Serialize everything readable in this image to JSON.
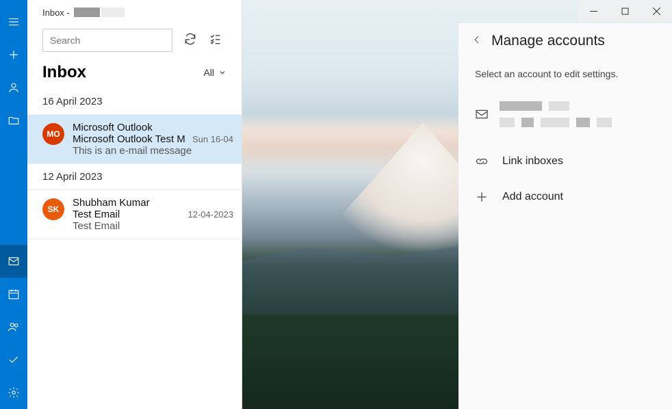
{
  "window": {
    "title_prefix": "Inbox -"
  },
  "search": {
    "placeholder": "Search"
  },
  "folder": {
    "name": "Inbox",
    "filter": "All"
  },
  "groups": [
    {
      "date": "16 April 2023",
      "messages": [
        {
          "initials": "MO",
          "from": "Microsoft Outlook",
          "subject": "Microsoft Outlook Test M",
          "date": "Sun 16-04",
          "preview": "This is an e-mail message"
        }
      ]
    },
    {
      "date": "12 April 2023",
      "messages": [
        {
          "initials": "SK",
          "from": "Shubham Kumar",
          "subject": "Test Email",
          "date": "12-04-2023",
          "preview": "Test Email"
        }
      ]
    }
  ],
  "panel": {
    "title": "Manage accounts",
    "subtitle": "Select an account to edit settings.",
    "link_inboxes": "Link inboxes",
    "add_account": "Add account"
  }
}
